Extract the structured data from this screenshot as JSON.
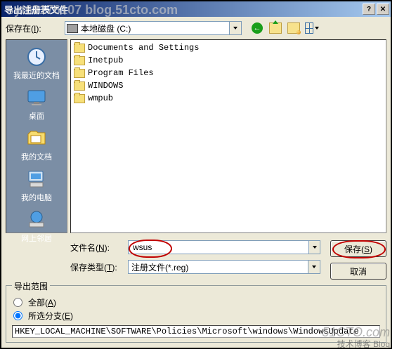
{
  "window": {
    "title": "导出注册表文件",
    "help_glyph": "?",
    "close_glyph": "✕"
  },
  "top": {
    "save_in_label_pre": "保存在(",
    "save_in_label_key": "I",
    "save_in_label_post": "):",
    "drive_text": "本地磁盘 (C:)"
  },
  "places": [
    {
      "id": "recent",
      "label": "我最近的文档"
    },
    {
      "id": "desktop",
      "label": "桌面"
    },
    {
      "id": "mydocs",
      "label": "我的文档"
    },
    {
      "id": "computer",
      "label": "我的电脑"
    },
    {
      "id": "network",
      "label": "网上邻居"
    }
  ],
  "files": [
    {
      "name": "Documents and Settings"
    },
    {
      "name": "Inetpub"
    },
    {
      "name": "Program Files"
    },
    {
      "name": "WINDOWS"
    },
    {
      "name": "wmpub"
    }
  ],
  "form": {
    "filename_label_pre": "文件名(",
    "filename_label_key": "N",
    "filename_label_post": "):",
    "filename_value": "wsus",
    "filetype_label_pre": "保存类型(",
    "filetype_label_key": "T",
    "filetype_label_post": "):",
    "filetype_value": "注册文件(*.reg)",
    "save_btn_pre": "保存(",
    "save_btn_key": "S",
    "save_btn_post": ")",
    "cancel_btn": "取消"
  },
  "export": {
    "group_title": "导出范围",
    "all_pre": "全部(",
    "all_key": "A",
    "all_post": ")",
    "branch_pre": "所选分支(",
    "branch_key": "E",
    "branch_post": ")",
    "branch_value": "HKEY_LOCAL_MACHINE\\SOFTWARE\\Policies\\Microsoft\\windows\\WindowsUpdate"
  },
  "watermarks": {
    "top": "syt63176107 blog.51cto.com",
    "br1": "51CTO.com",
    "br2": "技术博客  Blog"
  }
}
